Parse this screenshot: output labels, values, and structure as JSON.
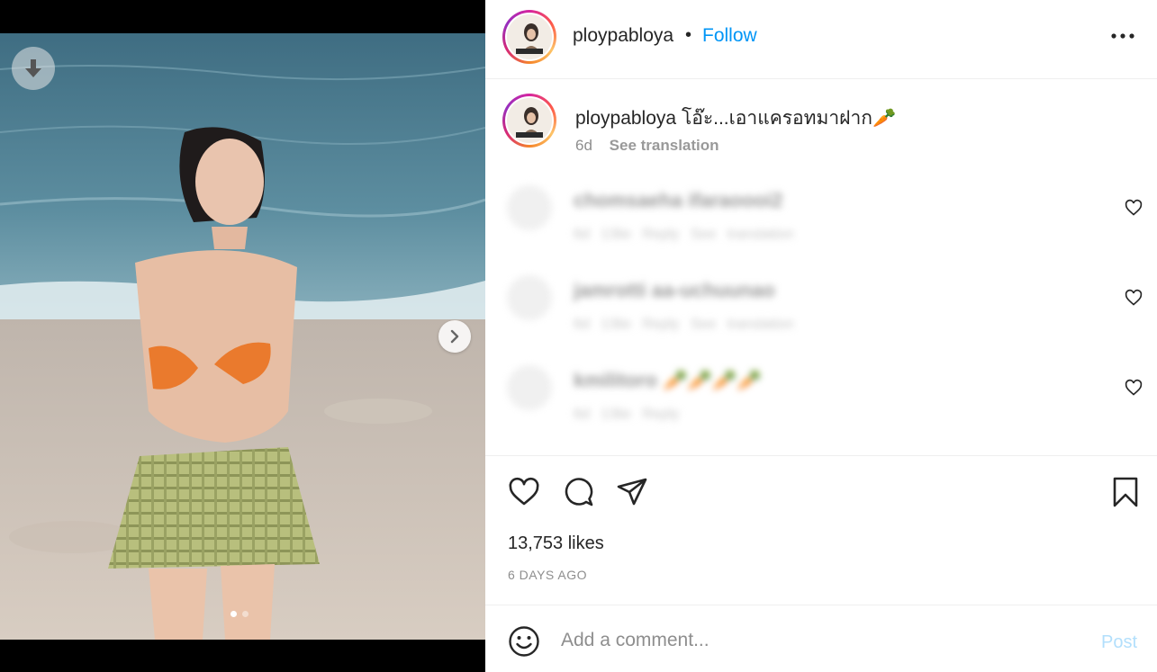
{
  "colors": {
    "link": "#0095f6",
    "post_disabled": "#b2dffc",
    "muted": "#8e8e8e"
  },
  "media": {
    "download_icon": "arrow-down-icon",
    "next_icon": "chevron-right-icon",
    "slide_count": 2,
    "active_slide": 1
  },
  "header": {
    "username": "ploypabloya",
    "separator": "•",
    "follow_label": "Follow",
    "more_icon": "more-horizontal-icon"
  },
  "caption": {
    "username": "ploypabloya",
    "text": "โอ๊ะ...เอาแครอทมาฝาก🥕",
    "age": "6d",
    "see_translation": "See translation"
  },
  "comments": [
    {
      "user": "chomsaeha ifaraoooi2",
      "meta": "6d 13lie Reply See translation"
    },
    {
      "user": "jamrotti aa-uchuunao",
      "meta": "6d 13lie Reply See translation"
    },
    {
      "user": "kmilitoro 🥕🥕🥕🥕",
      "meta": "6d 13lie Reply"
    }
  ],
  "actions": {
    "like_icon": "heart-icon",
    "comment_icon": "comment-icon",
    "share_icon": "paper-plane-icon",
    "save_icon": "bookmark-icon",
    "likes": "13,753 likes",
    "date": "6 DAYS AGO"
  },
  "composer": {
    "emoji_icon": "emoji-icon",
    "placeholder": "Add a comment...",
    "post_label": "Post"
  }
}
